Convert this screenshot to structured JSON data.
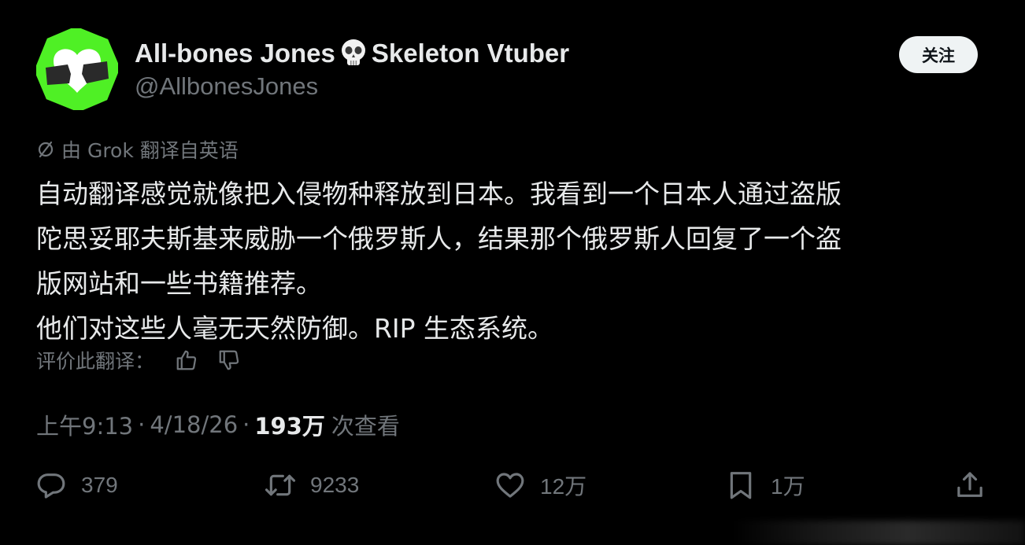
{
  "author": {
    "display_name_part1": "All-bones Jones",
    "display_name_part2": "Skeleton Vtuber",
    "name_emoji_icon": "skull-icon",
    "handle": "@AllbonesJones",
    "avatar_colors": {
      "outer": "#4ff025",
      "inner": "#ffffff",
      "dark": "#2a2a2a"
    }
  },
  "follow_button": {
    "label": "关注"
  },
  "translation_note": {
    "icon": "translate-slash-icon",
    "text": "由 Grok 翻译自英语"
  },
  "tweet_lines": [
    "自动翻译感觉就像把入侵物种释放到日本。我看到一个日本人通过盗版",
    "陀思妥耶夫斯基来威胁一个俄罗斯人，结果那个俄罗斯人回复了一个盗",
    "版网站和一些书籍推荐。",
    "他们对这些人毫无天然防御。RIP 生态系统。"
  ],
  "rate": {
    "label": "评价此翻译：",
    "up_icon": "thumbs-up-icon",
    "down_icon": "thumbs-down-icon"
  },
  "meta": {
    "time": "上午9:13",
    "sep": "·",
    "date": "4/18/26",
    "views_count": "193万",
    "views_label": "次查看"
  },
  "actions": {
    "reply": {
      "icon": "reply-icon",
      "count": "379"
    },
    "retweet": {
      "icon": "retweet-icon",
      "count": "9233"
    },
    "like": {
      "icon": "heart-icon",
      "count": "12万"
    },
    "bookmark": {
      "icon": "bookmark-icon",
      "count": "1万"
    },
    "share": {
      "icon": "share-icon"
    }
  },
  "colors": {
    "background": "#000000",
    "text_primary": "#e7e9ea",
    "text_secondary": "#71767b",
    "button_bg": "#eff3f4",
    "button_text": "#0f1419"
  }
}
